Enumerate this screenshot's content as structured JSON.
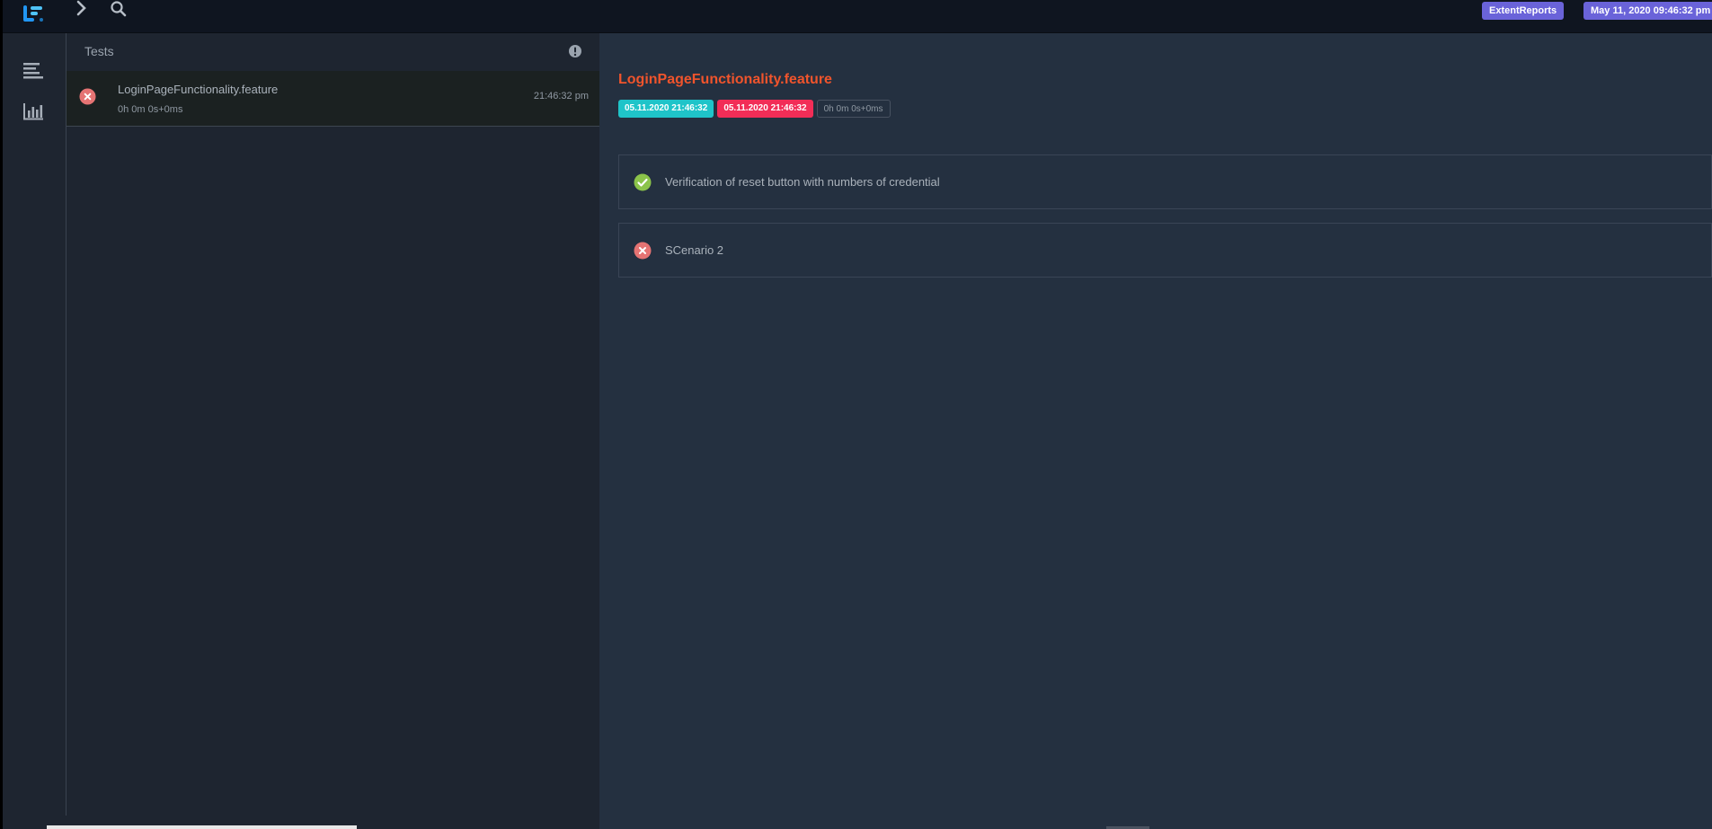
{
  "navbar": {
    "brand_badge": "ExtentReports",
    "date_badge": "May 11, 2020 09:46:32 pm"
  },
  "tests_panel": {
    "title": "Tests",
    "items": [
      {
        "name": "LoginPageFunctionality.feature",
        "duration": "0h 0m 0s+0ms",
        "time": "21:46:32 pm",
        "status": "fail"
      }
    ]
  },
  "detail": {
    "title": "LoginPageFunctionality.feature",
    "start_time": "05.11.2020 21:46:32",
    "end_time": "05.11.2020 21:46:32",
    "duration": "0h 0m 0s+0ms",
    "scenarios": [
      {
        "label": "Verification of reset button with numbers of credential",
        "status": "pass"
      },
      {
        "label": "SCenario 2",
        "status": "fail"
      }
    ]
  },
  "colors": {
    "navbar_bg": "#0f1520",
    "panel_bg": "#1e2530",
    "detail_bg": "#243040",
    "badge": "#6a63d9",
    "title_accent": "#f0542c",
    "pill_start": "#1fc4c9",
    "pill_end": "#f22d57",
    "pass": "#8bc34a",
    "fail": "#e57373"
  },
  "icons": {
    "logo": "extent-logo-icon",
    "nav_toggle": "chevron-right-icon",
    "search": "search-icon",
    "rail_tests": "list-icon",
    "rail_dashboard": "bar-chart-icon",
    "tests_info": "exclamation-circle-icon",
    "pass": "check-circle-icon",
    "fail": "x-circle-icon"
  }
}
